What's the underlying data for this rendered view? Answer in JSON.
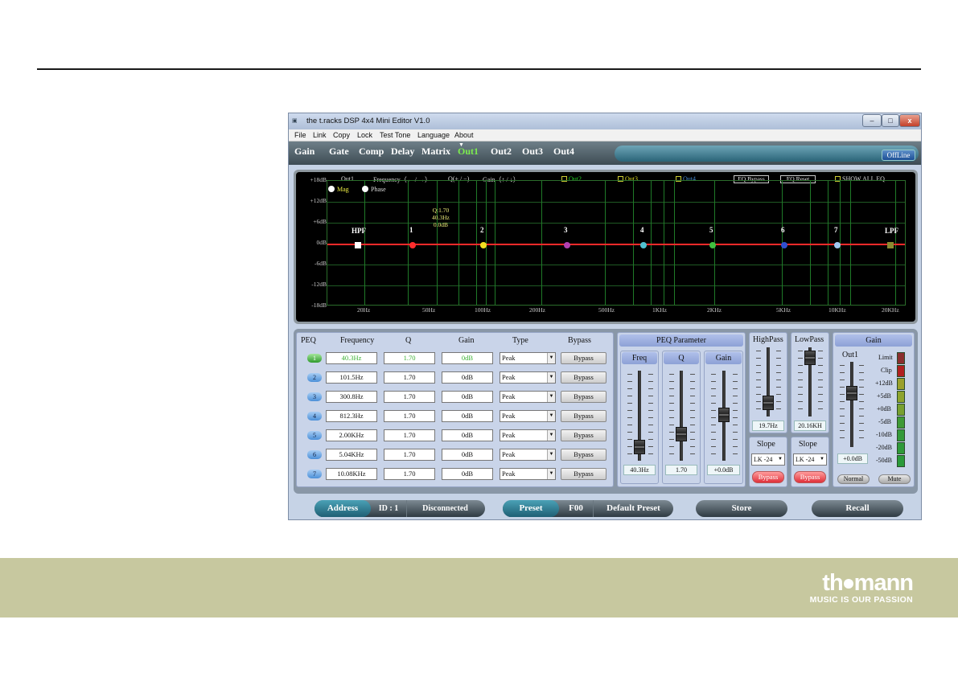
{
  "window": {
    "title": "the t.racks DSP 4x4 Mini Editor V1.0",
    "min": "–",
    "max": "□",
    "close": "x"
  },
  "menu": [
    "File",
    "Link",
    "Copy",
    "Lock",
    "Test Tone",
    "Language",
    "About"
  ],
  "tabs": [
    {
      "label": "Gain"
    },
    {
      "label": "Gate"
    },
    {
      "label": "Comp"
    },
    {
      "label": "Delay"
    },
    {
      "label": "Matrix"
    },
    {
      "label": "Out1",
      "active": true
    },
    {
      "label": "Out2"
    },
    {
      "label": "Out3"
    },
    {
      "label": "Out4"
    }
  ],
  "offline_label": "OffLine",
  "graph": {
    "channel": "Out1",
    "freq_hint": "Frequency（← / →）",
    "q_hint": "Q(+ / −)",
    "gain_hint": "Gain（↑ / ↓）",
    "legend": [
      "Out2",
      "Out3",
      "Out4"
    ],
    "eq_bypass": "EQ Bypass",
    "eq_reset": "EQ Reset",
    "show_all": "SHOW ALL EQ",
    "mag": "Mag",
    "phase": "Phase",
    "y_labels": [
      "+18dB",
      "+12dB",
      "+6dB",
      "0dB",
      "-6dB",
      "-12dB",
      "-18dB"
    ],
    "x_labels": [
      "20Hz",
      "50Hz",
      "100Hz",
      "200Hz",
      "500Hz",
      "1KHz",
      "2KHz",
      "5KHz",
      "10KHz",
      "20KHz"
    ],
    "q_info": [
      "Q:1.70",
      "40.3Hz",
      "0.0dB"
    ],
    "points": [
      {
        "label": "HPF",
        "color": "#ffffff"
      },
      {
        "label": "1",
        "color": "#ff2d2d"
      },
      {
        "label": "2",
        "color": "#f0e020"
      },
      {
        "label": "3",
        "color": "#b040b0"
      },
      {
        "label": "4",
        "color": "#50c0d0"
      },
      {
        "label": "5",
        "color": "#40c040"
      },
      {
        "label": "6",
        "color": "#3050d0"
      },
      {
        "label": "7",
        "color": "#a0c8f0"
      },
      {
        "label": "LPF",
        "color": "#8a8a30"
      }
    ]
  },
  "peq": {
    "headers": [
      "PEQ",
      "Frequency",
      "Q",
      "Gain",
      "Type",
      "Bypass"
    ],
    "rows": [
      {
        "n": "1",
        "freq": "40.3Hz",
        "q": "1.70",
        "gain": "0dB",
        "type": "Peak",
        "bypass": "Bypass"
      },
      {
        "n": "2",
        "freq": "101.5Hz",
        "q": "1.70",
        "gain": "0dB",
        "type": "Peak",
        "bypass": "Bypass"
      },
      {
        "n": "3",
        "freq": "300.8Hz",
        "q": "1.70",
        "gain": "0dB",
        "type": "Peak",
        "bypass": "Bypass"
      },
      {
        "n": "4",
        "freq": "812.3Hz",
        "q": "1.70",
        "gain": "0dB",
        "type": "Peak",
        "bypass": "Bypass"
      },
      {
        "n": "5",
        "freq": "2.00KHz",
        "q": "1.70",
        "gain": "0dB",
        "type": "Peak",
        "bypass": "Bypass"
      },
      {
        "n": "6",
        "freq": "5.04KHz",
        "q": "1.70",
        "gain": "0dB",
        "type": "Peak",
        "bypass": "Bypass"
      },
      {
        "n": "7",
        "freq": "10.08KHz",
        "q": "1.70",
        "gain": "0dB",
        "type": "Peak",
        "bypass": "Bypass"
      }
    ]
  },
  "peq_param": {
    "title": "PEQ Parameter",
    "freq": "Freq",
    "q": "Q",
    "gain": "Gain",
    "freq_val": "40.3Hz",
    "q_val": "1.70",
    "gain_val": "+0.0dB"
  },
  "highpass": {
    "title": "HighPass",
    "value": "19.7Hz",
    "slope_title": "Slope",
    "slope": "LK -24",
    "bypass": "Bypass"
  },
  "lowpass": {
    "title": "LowPass",
    "value": "20.16KH",
    "slope_title": "Slope",
    "slope": "LK -24",
    "bypass": "Bypass"
  },
  "gain": {
    "title": "Gain",
    "channel": "Out1",
    "value": "+0.0dB",
    "normal": "Normal",
    "mute": "Mute",
    "meter_labels": [
      "Limit",
      "Clip",
      "+12dB",
      "+5dB",
      "+0dB",
      "-5dB",
      "-10dB",
      "-20dB",
      "-50dB"
    ]
  },
  "bottom": {
    "address": "Address",
    "id": "ID : 1",
    "status": "Disconnected",
    "preset": "Preset",
    "preset_no": "F00",
    "preset_name": "Default Preset",
    "store": "Store",
    "recall": "Recall"
  },
  "brand": {
    "name_a": "th",
    "name_b": "mann",
    "slogan": "MUSIC IS OUR PASSION"
  }
}
